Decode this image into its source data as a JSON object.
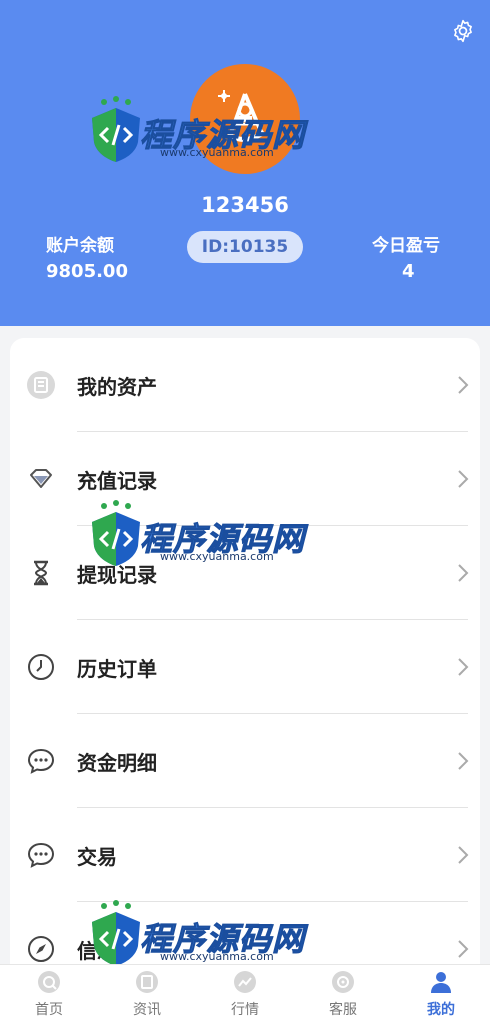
{
  "header": {
    "username": "123456",
    "id_badge": "ID:10135",
    "balance_label": "账户余额",
    "balance_value": "9805.00",
    "today_pnl_label": "今日盈亏",
    "today_pnl_value": "4",
    "background_color": "#5a8bf0",
    "avatar_color": "#f07a22"
  },
  "menu": {
    "items": [
      {
        "label": "我的资产",
        "icon": "wallet-icon"
      },
      {
        "label": "充值记录",
        "icon": "diamond-icon"
      },
      {
        "label": "提现记录",
        "icon": "hourglass-icon"
      },
      {
        "label": "历史订单",
        "icon": "clock-icon"
      },
      {
        "label": "资金明细",
        "icon": "chat-bubble-icon"
      },
      {
        "label": "交易",
        "icon": "chat-bubble-icon"
      },
      {
        "label": "信息",
        "icon": "compass-icon"
      }
    ]
  },
  "nav": {
    "items": [
      {
        "label": "首页",
        "icon": "home-icon"
      },
      {
        "label": "资讯",
        "icon": "news-icon"
      },
      {
        "label": "行情",
        "icon": "market-icon"
      },
      {
        "label": "客服",
        "icon": "service-icon"
      },
      {
        "label": "我的",
        "icon": "user-icon"
      }
    ],
    "active_color": "#3c6fd8"
  },
  "watermark": {
    "title_part1": "程序",
    "title_part2": "源码网",
    "url": "www.cxyuanma.com"
  }
}
